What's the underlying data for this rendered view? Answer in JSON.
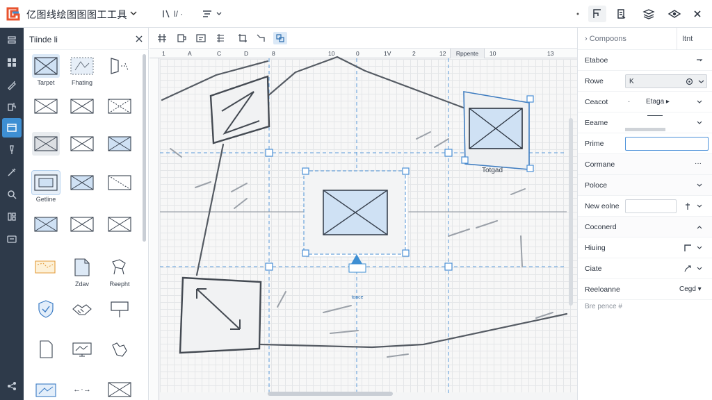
{
  "app": {
    "title": "亿图线绘图图图工工具",
    "brand_color": "#e8532e",
    "accent": "#3e8fd3"
  },
  "topbar": {
    "left_tools": [
      {
        "icon": "pen-line-icon",
        "label": "l/ ·"
      },
      {
        "icon": "style-icon",
        "label": ""
      }
    ],
    "right_tools": [
      "frame-icon",
      "document-icon",
      "layers-icon",
      "preview-icon",
      "close-icon"
    ]
  },
  "rail": {
    "items": [
      "pages-icon",
      "grid-icon",
      "pen-icon",
      "import-icon",
      "shapes-icon",
      "brush-icon",
      "eyedropper-icon",
      "search-icon",
      "layout-icon",
      "inbox-icon",
      "share-icon"
    ],
    "active_index": 4
  },
  "library": {
    "title": "Tiinde  li",
    "shapes": [
      {
        "label": "Tarpet"
      },
      {
        "label": "Fhating"
      },
      {
        "label": ""
      },
      {
        "label": ""
      },
      {
        "label": ""
      },
      {
        "label": ""
      },
      {
        "label": ""
      },
      {
        "label": ""
      },
      {
        "label": ""
      },
      {
        "label": "Getline"
      },
      {
        "label": ""
      },
      {
        "label": ""
      },
      {
        "label": ""
      },
      {
        "label": ""
      },
      {
        "label": ""
      },
      {
        "label": ""
      },
      {
        "label": "Zdav"
      },
      {
        "label": "Reepht"
      },
      {
        "label": ""
      },
      {
        "label": ""
      },
      {
        "label": ""
      },
      {
        "label": ""
      },
      {
        "label": ""
      },
      {
        "label": ""
      },
      {
        "label": ""
      },
      {
        "label": "←·→"
      },
      {
        "label": ""
      }
    ]
  },
  "canvas": {
    "ruler_labels": [
      "1",
      "A",
      "C",
      "D",
      "8",
      "10",
      "0",
      "1V",
      "2",
      "12",
      "10",
      "13"
    ],
    "ruler_tab": "Rppente",
    "target_label": "Totgad",
    "anchor_label": "tonce"
  },
  "properties": {
    "title": "Compoons",
    "tab": "Itnt",
    "rows": [
      {
        "label": "Etaboe",
        "value": ""
      },
      {
        "label": "Rowe",
        "value": "K"
      },
      {
        "label": "Ceacot",
        "value": "Etaga ▸"
      },
      {
        "label": "Eeame",
        "value": ""
      },
      {
        "label": "Prime",
        "value": ""
      },
      {
        "label": "Cormane",
        "value": "···"
      },
      {
        "label": "Poloce",
        "value": ""
      },
      {
        "label": "New eolne",
        "value": ""
      },
      {
        "label": "Coconerd",
        "value": ""
      },
      {
        "label": "Hiuing",
        "value": ""
      },
      {
        "label": "Ciate",
        "value": ""
      },
      {
        "label": "Reeloanne",
        "value": "Cegd ▾"
      }
    ],
    "footer": "Bre pence  #"
  }
}
